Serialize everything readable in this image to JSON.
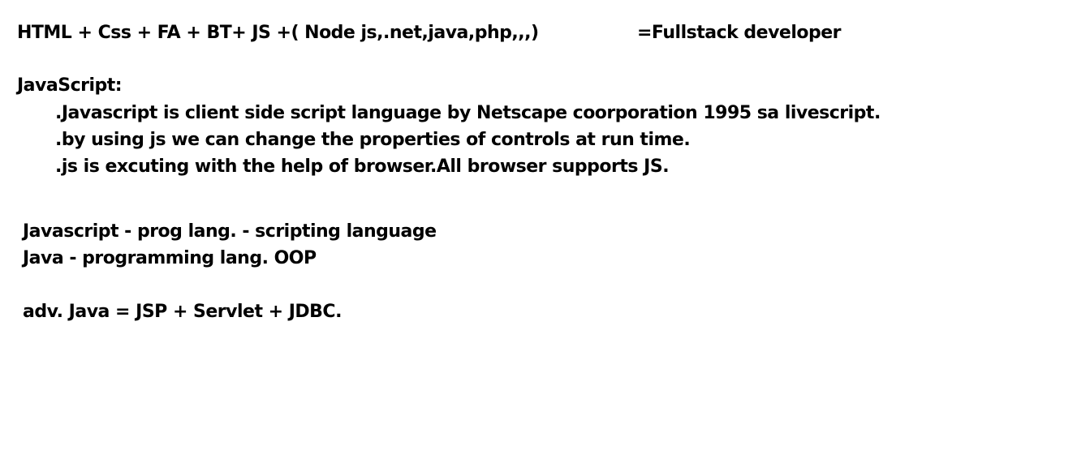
{
  "header": {
    "formula": "HTML + Css + FA + BT+ JS +( Node js,.net,java,php,,,)",
    "result": "=Fullstack developer"
  },
  "javascript_section": {
    "title": "JavaScript:",
    "points": [
      ".Javascript is client side script language by Netscape coorporation 1995 sa livescript.",
      ".by using js we can change the properties of controls at run time.",
      ".js is excuting with the help of browser.All browser supports JS."
    ]
  },
  "comparison": {
    "lines": [
      "Javascript - prog lang. - scripting language",
      "Java - programming lang. OOP"
    ]
  },
  "advanced_java": "adv. Java = JSP + Servlet + JDBC."
}
